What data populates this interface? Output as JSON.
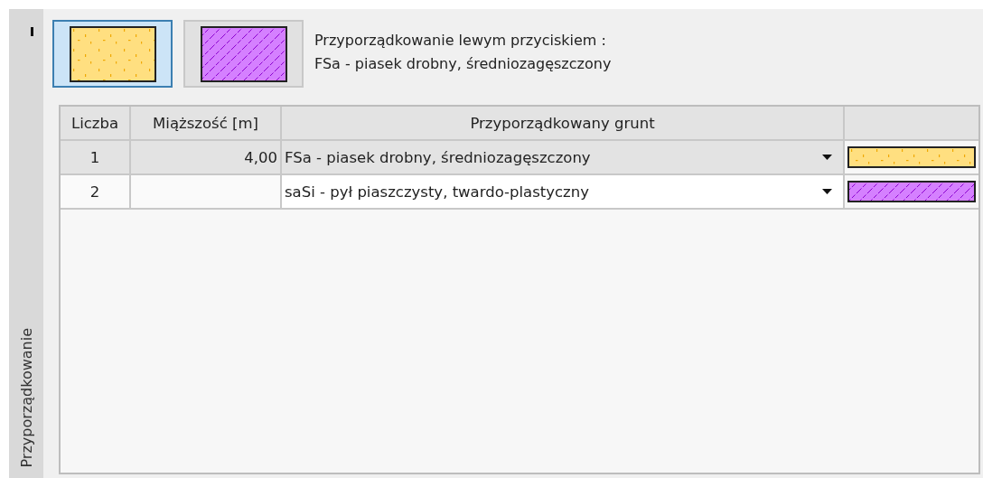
{
  "side_tab": {
    "label": "Przyporządkowanie"
  },
  "swatches": [
    {
      "kind": "sand",
      "color": "#ffdf80",
      "selected": true
    },
    {
      "kind": "silt",
      "color": "#d580ff",
      "selected": false
    }
  ],
  "assignment_info": {
    "line_1": "Przyporządkowanie lewym przyciskiem :",
    "line_2": "FSa - piasek drobny, średniozagęszczony"
  },
  "table": {
    "columns": [
      "Liczba",
      "Miąższość [m]",
      "Przyporządkowany grunt"
    ],
    "rows": [
      {
        "number": "1",
        "thickness": "4,00",
        "soil": "FSa - piasek drobny, średniozagęszczony",
        "pattern": {
          "kind": "sand",
          "color": "#ffdf80"
        },
        "selected": true
      },
      {
        "number": "2",
        "soil": "saSi - pył piaszczysty, twardo-plastyczny",
        "pattern": {
          "kind": "silt",
          "color": "#d580ff"
        },
        "selected": false
      }
    ]
  }
}
